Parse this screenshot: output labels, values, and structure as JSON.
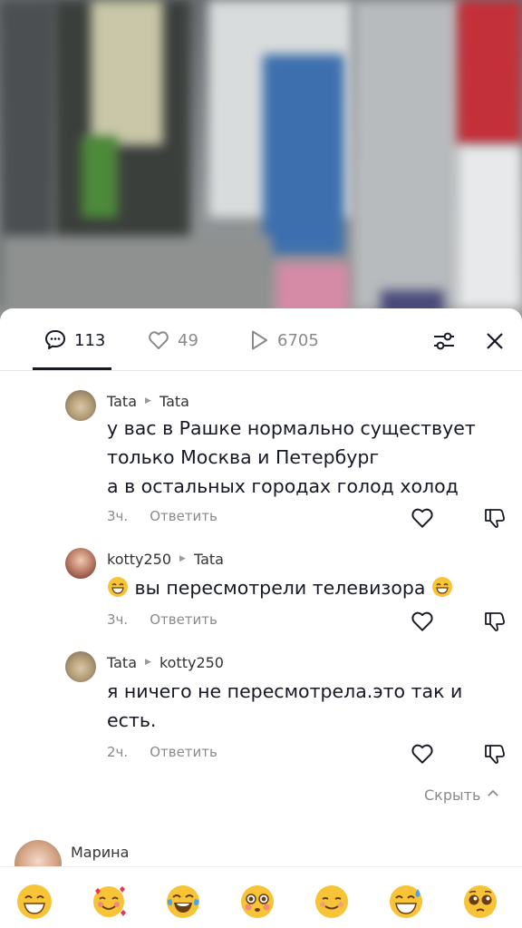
{
  "tabs": {
    "comments_count": "113",
    "likes_count": "49",
    "views_count": "6705"
  },
  "comments": [
    {
      "author": "Tata",
      "reply_to": "Tata",
      "lines": [
        "у вас в Рашке нормально существует",
        "только Москва и Петербург",
        "а в остальных городах голод холод"
      ],
      "time": "3ч.",
      "reply_label": "Ответить"
    },
    {
      "author": "kotty250",
      "reply_to": "Tata",
      "text": "вы пересмотрели телевизора",
      "time": "3ч.",
      "reply_label": "Ответить"
    },
    {
      "author": "Tata",
      "reply_to": "kotty250",
      "lines": [
        "я ничего не пересмотрела.это так и",
        "есть."
      ],
      "time": "2ч.",
      "reply_label": "Ответить"
    }
  ],
  "hide_label": "Скрыть",
  "next_comment": {
    "author": "Марина"
  },
  "emoji_bar": [
    "grin",
    "smiling-hearts",
    "tears-of-joy",
    "flushed",
    "smiling",
    "sweat-smile",
    "pleading"
  ],
  "colors": {
    "text": "#161823",
    "muted": "#8a8a8a",
    "divider": "#e6e6e6",
    "emoji": "#f7c437"
  }
}
